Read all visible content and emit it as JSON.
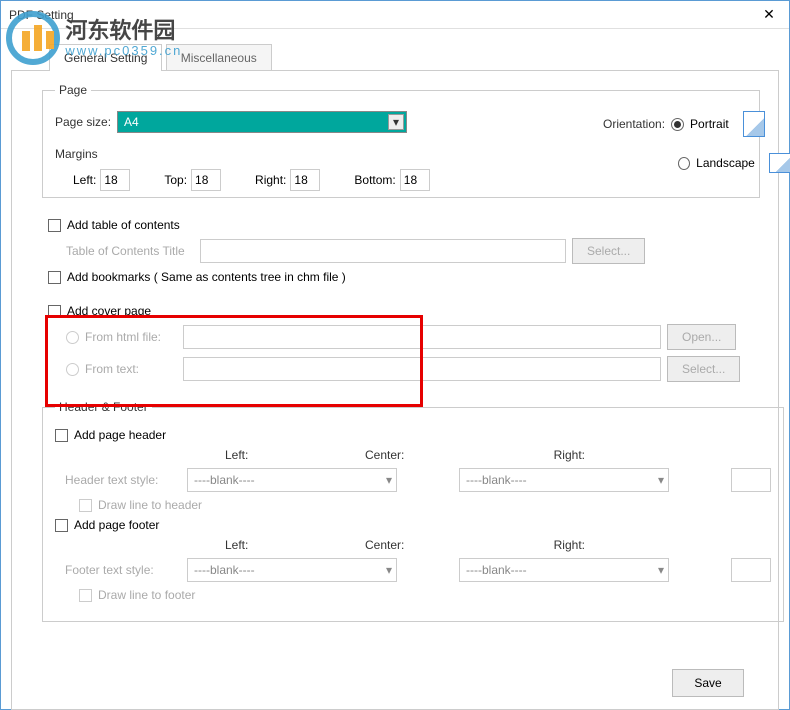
{
  "window": {
    "title": "PDF Setting"
  },
  "watermark": {
    "main": "河东软件园",
    "sub": "www.pc0359.cn"
  },
  "tabs": {
    "general": "General Setting",
    "misc": "Miscellaneous"
  },
  "page": {
    "legend": "Page",
    "size_label": "Page size:",
    "size_value": "A4",
    "orientation_label": "Orientation:",
    "portrait": "Portrait",
    "landscape": "Landscape",
    "margins_label": "Margins",
    "left_label": "Left:",
    "left_val": "18",
    "top_label": "Top:",
    "top_val": "18",
    "right_label": "Right:",
    "right_val": "18",
    "bottom_label": "Bottom:",
    "bottom_val": "18"
  },
  "toc": {
    "add_toc": "Add table of contents",
    "title_label": "Table of Contents Title",
    "select_btn": "Select...",
    "add_bookmarks": "Add  bookmarks ( Same as contents tree in chm file )"
  },
  "cover": {
    "add_cover": "Add cover page",
    "from_html": "From html file:",
    "from_text": "From  text:",
    "open_btn": "Open...",
    "select_btn": "Select..."
  },
  "hf": {
    "legend": "Header & Footer",
    "add_header": "Add page header",
    "add_footer": "Add page footer",
    "left": "Left:",
    "center": "Center:",
    "right": "Right:",
    "header_style": "Header text style:",
    "footer_style": "Footer text style:",
    "blank": "----blank----",
    "draw_header": "Draw line to header",
    "draw_footer": "Draw line to footer"
  },
  "save": "Save"
}
